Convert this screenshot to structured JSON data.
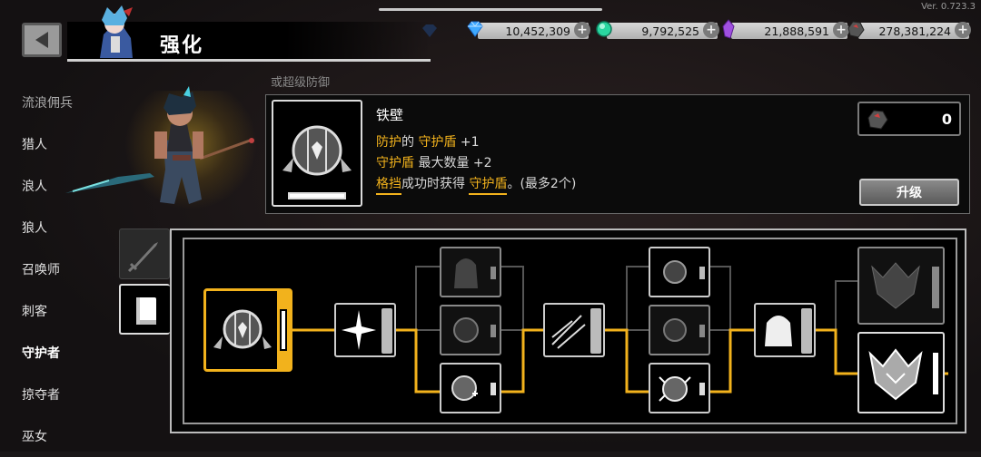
{
  "version": "Ver. 0.723.3",
  "page_title": "强化",
  "currencies": [
    {
      "name": "diamond",
      "icon": "diamond-icon",
      "value": "10,452,309",
      "color": "#3fa9ff"
    },
    {
      "name": "green-orb",
      "icon": "green-orb-icon",
      "value": "9,792,525",
      "color": "#2ad6a0"
    },
    {
      "name": "purple-crystal",
      "icon": "purple-crystal-icon",
      "value": "21,888,591",
      "color": "#a050e0"
    },
    {
      "name": "ore",
      "icon": "ore-icon",
      "value": "278,381,224",
      "color": "#c04040"
    }
  ],
  "classes": [
    {
      "label": "流浪佣兵",
      "state": "partial"
    },
    {
      "label": "猎人"
    },
    {
      "label": "浪人"
    },
    {
      "label": "狼人"
    },
    {
      "label": "召唤师"
    },
    {
      "label": "刺客"
    },
    {
      "label": "守护者",
      "state": "active"
    },
    {
      "label": "掠夺者"
    },
    {
      "label": "巫女"
    }
  ],
  "info_header": "或超级防御",
  "skill": {
    "name": "铁壁",
    "line1_a": "防护",
    "line1_b": "的 ",
    "line1_c": "守护盾",
    "line1_d": " +1",
    "line2_a": "守护盾",
    "line2_b": " 最大数量 +2",
    "line3_a": "格挡",
    "line3_b": "成功时获得 ",
    "line3_c": "守护盾",
    "line3_d": "。(最多2个)",
    "cost": "0",
    "upgrade_label": "升级"
  },
  "colors": {
    "accent": "#f2b21c",
    "panel_border": "#bcbcbc"
  }
}
